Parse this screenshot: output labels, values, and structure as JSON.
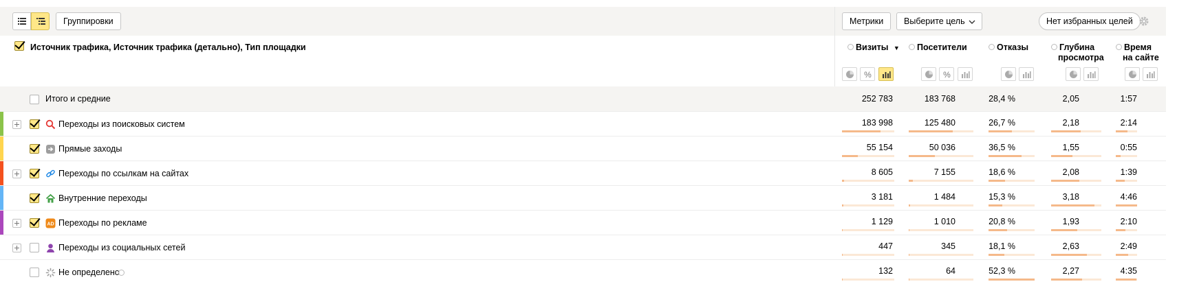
{
  "toolbar": {
    "groupings_label": "Группировки",
    "metrics_label": "Метрики",
    "goal_select_label": "Выберите цель",
    "favorites_label": "Нет избранных целей"
  },
  "header": {
    "dimension_title": "Источник трафика, Источник трафика (детально), Тип площадки",
    "columns": [
      {
        "line1": "Визиты",
        "line2": "",
        "sort": "▼"
      },
      {
        "line1": "Посетители",
        "line2": ""
      },
      {
        "line1": "Отказы",
        "line2": ""
      },
      {
        "line1": "Глубина",
        "line2": "просмотра"
      },
      {
        "line1": "Время",
        "line2": "на сайте"
      }
    ]
  },
  "totals": {
    "label": "Итого и средние",
    "visits": "252 783",
    "visitors": "183 768",
    "bounce": "28,4 %",
    "depth": "2,05",
    "time": "1:57"
  },
  "rows": [
    {
      "label": "Переходы из поисковых систем",
      "icon": "search-icon",
      "color": "#8bc34a",
      "checked": true,
      "expandable": true,
      "visits": "183 998",
      "visitors": "125 480",
      "bounce": "26,7 %",
      "depth": "2,18",
      "time": "2:14",
      "bars": [
        0.73,
        0.68,
        0.51,
        0.59,
        0.55
      ]
    },
    {
      "label": "Прямые заходы",
      "icon": "arrow-enter-icon",
      "color": "#ffd54f",
      "checked": true,
      "expandable": false,
      "visits": "55 154",
      "visitors": "50 036",
      "bounce": "36,5 %",
      "depth": "1,55",
      "time": "0:55",
      "bars": [
        0.3,
        0.4,
        0.71,
        0.42,
        0.23
      ]
    },
    {
      "label": "Переходы по ссылкам на сайтах",
      "icon": "link-icon",
      "color": "#f4511e",
      "checked": true,
      "expandable": true,
      "visits": "8 605",
      "visitors": "7 155",
      "bounce": "18,6 %",
      "depth": "2,08",
      "time": "1:39",
      "bars": [
        0.04,
        0.06,
        0.36,
        0.56,
        0.41
      ]
    },
    {
      "label": "Внутренние переходы",
      "icon": "home-icon",
      "color": "#64b5f6",
      "checked": true,
      "expandable": false,
      "visits": "3 181",
      "visitors": "1 484",
      "bounce": "15,3 %",
      "depth": "3,18",
      "time": "4:46",
      "bars": [
        0.02,
        0.02,
        0.3,
        0.86,
        1.0
      ]
    },
    {
      "label": "Переходы по рекламе",
      "icon": "ad-icon",
      "color": "#ab47bc",
      "checked": true,
      "expandable": true,
      "visits": "1 129",
      "visitors": "1 010",
      "bounce": "20,8 %",
      "depth": "1,93",
      "time": "2:10",
      "bars": [
        0.01,
        0.01,
        0.4,
        0.52,
        0.45
      ]
    },
    {
      "label": "Переходы из социальных сетей",
      "icon": "person-icon",
      "color": "",
      "checked": false,
      "expandable": true,
      "visits": "447",
      "visitors": "345",
      "bounce": "18,1 %",
      "depth": "2,63",
      "time": "2:49",
      "bars": [
        0.005,
        0.005,
        0.35,
        0.71,
        0.59
      ]
    },
    {
      "label": "Не определено",
      "icon": "spinner-icon",
      "color": "",
      "checked": false,
      "expandable": false,
      "visits": "132",
      "visitors": "64",
      "bounce": "52,3 %",
      "depth": "2,27",
      "time": "4:35",
      "bars": [
        0.002,
        0.002,
        1.0,
        0.61,
        0.96
      ]
    }
  ],
  "colors": {
    "accent_yellow": "#ffe788",
    "bar_fill": "#f5b98a",
    "bar_track": "#fbe8d6",
    "toolbar_bg": "#f5f4f2"
  }
}
